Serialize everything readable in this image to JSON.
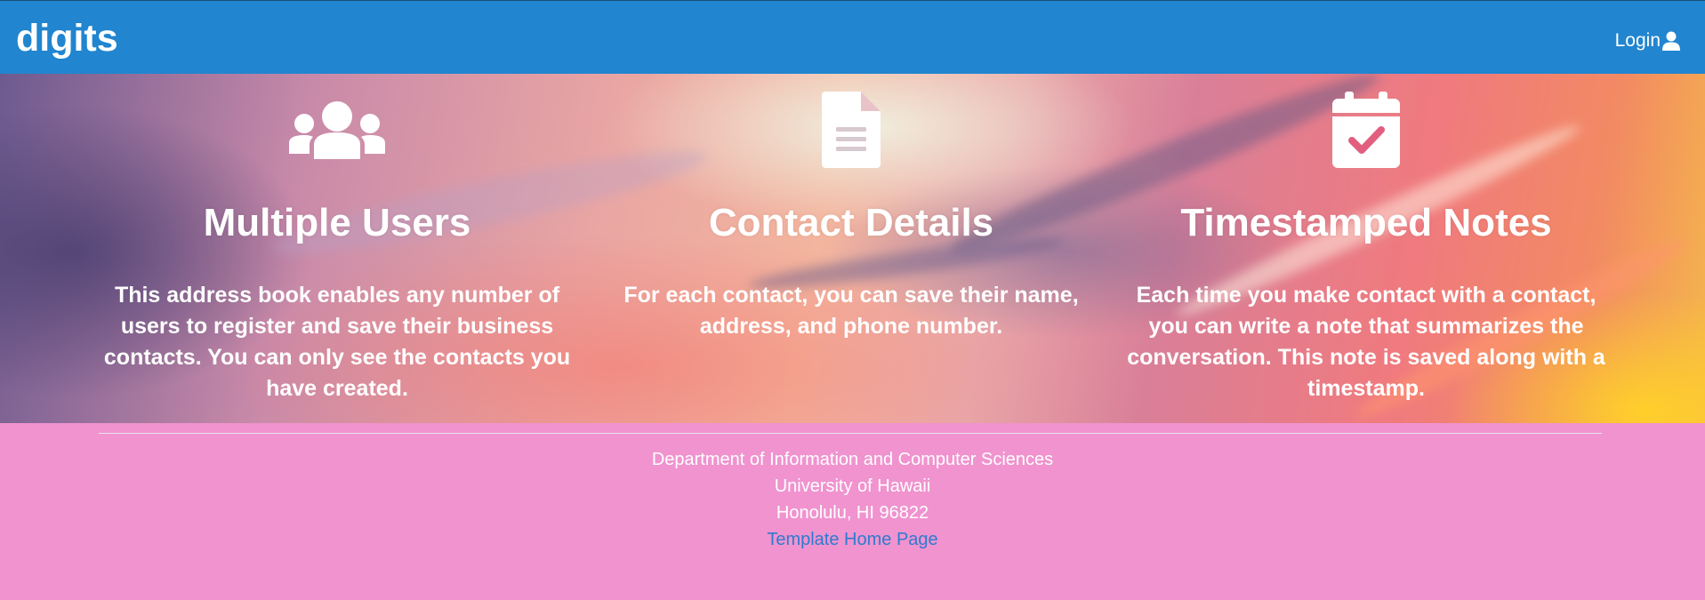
{
  "navbar": {
    "brand": "digits",
    "login_label": "Login",
    "color": "#2185d0"
  },
  "features": [
    {
      "icon": "users-icon",
      "title": "Multiple Users",
      "description": "This address book enables any number of users to register and save their business contacts. You can only see the contacts you have created."
    },
    {
      "icon": "file-text-icon",
      "title": "Contact Details",
      "description": "For each contact, you can save their name, address, and phone number."
    },
    {
      "icon": "calendar-check-icon",
      "title": "Timestamped Notes",
      "description": "Each time you make contact with a contact, you can write a note that summarizes the conversation. This note is saved along with a timestamp."
    }
  ],
  "footer": {
    "line1": "Department of Information and Computer Sciences",
    "line2": "University of Hawaii",
    "line3": "Honolulu, HI 96822",
    "link_label": "Template Home Page",
    "background": "#f093cf",
    "link_color": "#2e7bcf"
  }
}
